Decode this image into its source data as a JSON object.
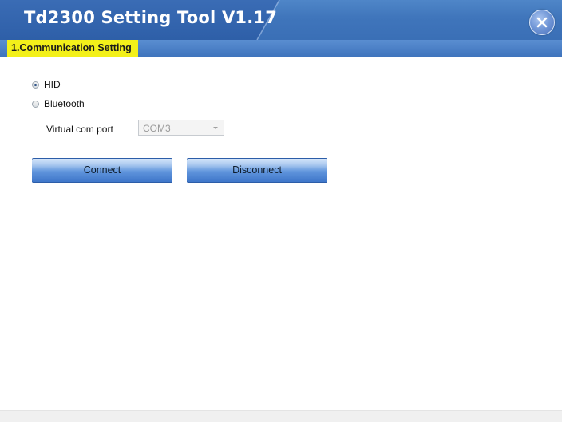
{
  "window": {
    "title": "Td2300 Setting Tool V1.17"
  },
  "tabs": [
    {
      "label": "1.Communication Setting",
      "active": true
    }
  ],
  "communication": {
    "options": [
      {
        "label": "HID",
        "selected": true
      },
      {
        "label": "Bluetooth",
        "selected": false
      }
    ],
    "virtual_com_port": {
      "label": "Virtual com port",
      "value": "COM3",
      "disabled": true
    },
    "buttons": {
      "connect": "Connect",
      "disconnect": "Disconnect"
    }
  },
  "icons": {
    "close": "close-icon",
    "dropdown": "chevron-down-icon"
  },
  "colors": {
    "title_bar": "#3f75bb",
    "active_tab": "#f3f01a",
    "button": "#5f94dc"
  }
}
